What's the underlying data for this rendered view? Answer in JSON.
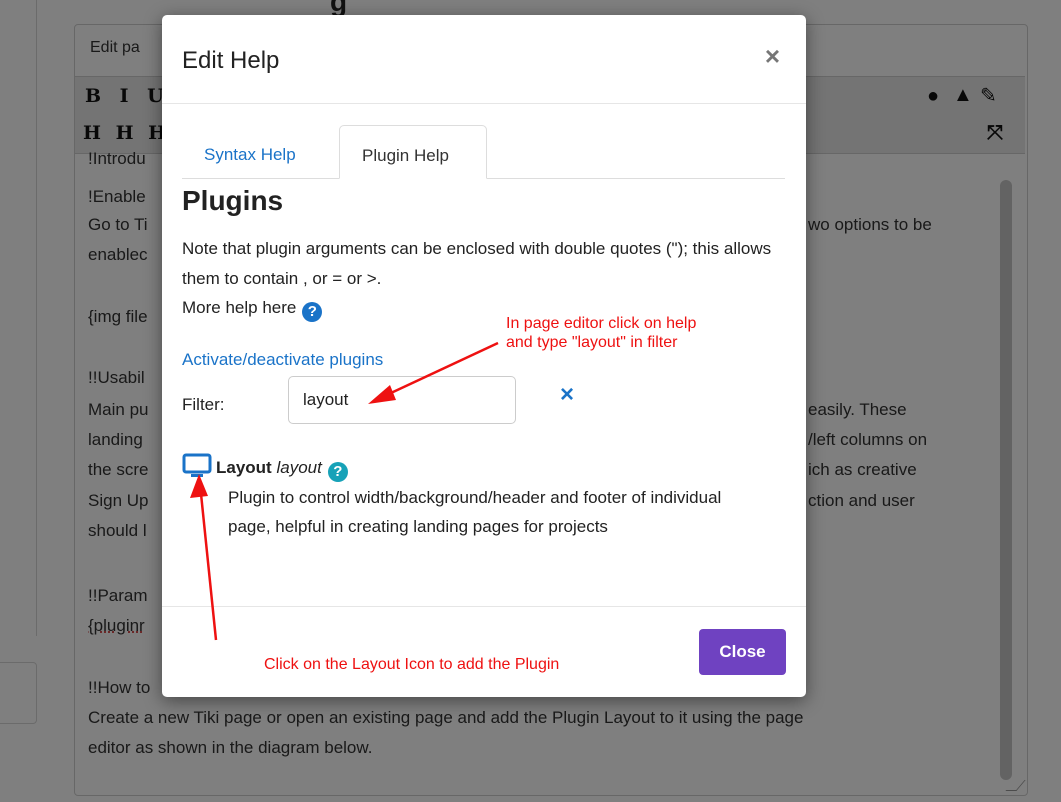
{
  "background": {
    "page_title_fragment": "g",
    "editor_tab": "Edit pa",
    "toolbar_row1": "B I U",
    "toolbar_row2": "H H H",
    "toolbar_right_icons": [
      "question-circle-icon",
      "warning-icon",
      "wrench-icon"
    ],
    "fullscreen_icon": "expand-icon",
    "lines": [
      {
        "text": "!Introdu",
        "extra": ""
      },
      {
        "text": "!Enable",
        "extra": ""
      },
      {
        "text": "Go to Ti",
        "extra": "wo options to be"
      },
      {
        "text": "enablec",
        "extra": ""
      },
      {
        "text": "{img file",
        "extra": ""
      },
      {
        "text": "!!Usabil",
        "extra": ""
      },
      {
        "text": "Main pu",
        "extra": "easily. These"
      },
      {
        "text": "landing",
        "extra": "/left columns on"
      },
      {
        "text": "the scre",
        "extra": "ich as creative"
      },
      {
        "text": "Sign Up",
        "extra": "ction and user"
      },
      {
        "text": "should l",
        "extra": ""
      },
      {
        "text": "!!Param",
        "extra": ""
      },
      {
        "text": "{pluginr",
        "extra": ""
      },
      {
        "text": "!!How to",
        "extra": ""
      },
      {
        "text": "Create a new Tiki page or open an existing page and add the Plugin Layout to it using the page",
        "extra": ""
      },
      {
        "text": "editor as shown in the diagram below.",
        "extra": ""
      }
    ]
  },
  "modal": {
    "title": "Edit Help",
    "close_x": "×",
    "tabs": [
      {
        "label": "Syntax Help",
        "active": false
      },
      {
        "label": "Plugin Help",
        "active": true
      }
    ],
    "heading": "Plugins",
    "note": "Note that plugin arguments can be enclosed with double quotes (\"); this allows them to contain , or = or >.",
    "more_help": "More help here",
    "activate_link": "Activate/deactivate plugins",
    "filter_label": "Filter:",
    "filter_value": "layout",
    "clear_icon": "×",
    "plugin": {
      "name": "Layout",
      "tag": "layout",
      "icon": "monitor-icon",
      "description": "Plugin to control width/background/header and footer of individual page, helpful in creating landing pages for projects"
    },
    "close_button": "Close",
    "accent_color": "#1a73c8",
    "button_color": "#6f42c1"
  },
  "annotations": {
    "top_right": "In page editor click on help\nand type \"layout\" in filter",
    "bottom": "Click on the Layout Icon to add the Plugin",
    "color": "#ee1111"
  }
}
